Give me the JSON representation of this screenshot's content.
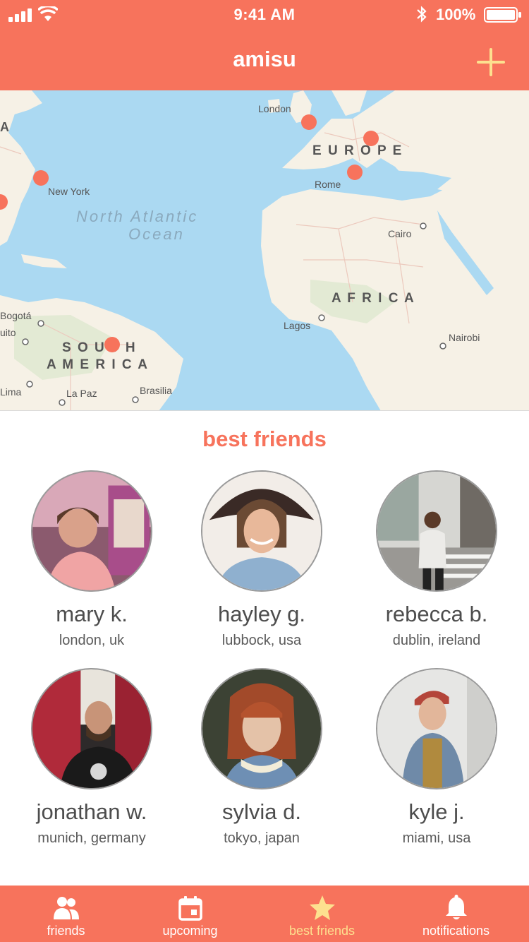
{
  "status_bar": {
    "time": "9:41 AM",
    "battery": "100%"
  },
  "header": {
    "title": "amisu"
  },
  "map": {
    "labels": {
      "london": "London",
      "europe": "E U R O P E",
      "rome": "Rome",
      "new_york": "New York",
      "atlantic_1": "North Atlantic",
      "atlantic_2": "Ocean",
      "cairo": "Cairo",
      "africa": "A F R I C A",
      "lagos": "Lagos",
      "nairobi": "Nairobi",
      "bogota": "Bogotá",
      "quito": "uito",
      "south_1": "S O U T H",
      "south_2": "A M E R I C A",
      "lima": "Lima",
      "la_paz": "La Paz",
      "brasilia": "Brasilia",
      "edge_a": "A"
    }
  },
  "section": {
    "title": "best friends"
  },
  "friends": [
    {
      "name": "mary k.",
      "location": "london, uk"
    },
    {
      "name": "hayley g.",
      "location": "lubbock, usa"
    },
    {
      "name": "rebecca b.",
      "location": "dublin, ireland"
    },
    {
      "name": "jonathan w.",
      "location": "munich, germany"
    },
    {
      "name": "sylvia d.",
      "location": "tokyo, japan"
    },
    {
      "name": "kyle j.",
      "location": "miami, usa"
    }
  ],
  "tabs": [
    {
      "label": "friends",
      "icon": "people-icon"
    },
    {
      "label": "upcoming",
      "icon": "calendar-icon"
    },
    {
      "label": "best friends",
      "icon": "star-icon"
    },
    {
      "label": "notifications",
      "icon": "bell-icon"
    }
  ],
  "colors": {
    "brand": "#f7735c",
    "accent": "#fde08f",
    "water": "#abd9f2",
    "land": "#f6f1e6"
  }
}
